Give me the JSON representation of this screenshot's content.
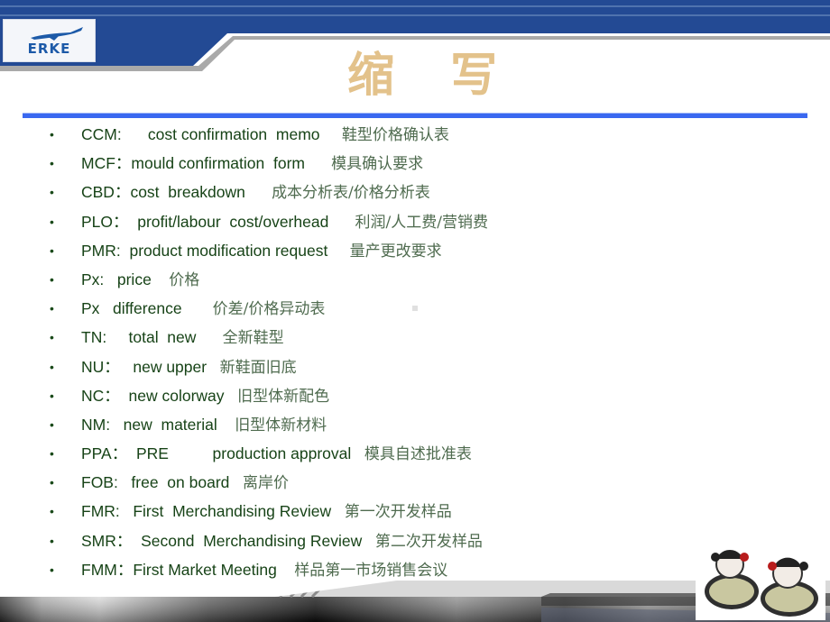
{
  "header": {
    "brand_logo_text": "ERKE",
    "colors": {
      "band": "#234a94",
      "band_shadow": "#a9a9a9",
      "title": "#e3c28b",
      "rule": "#3a68f0",
      "text": "#174317"
    }
  },
  "title": "缩 写",
  "items": [
    {
      "bullet": "•",
      "en": "CCM:      cost confirmation  memo     ",
      "cn": "鞋型价格确认表"
    },
    {
      "bullet": "•",
      "en": "MCF：mould confirmation  form      ",
      "cn": "模具确认要求"
    },
    {
      "bullet": "•",
      "en": "CBD：cost  breakdown      ",
      "cn": "成本分析表/价格分析表"
    },
    {
      "bullet": "•",
      "en": "PLO：  profit/labour  cost/overhead      ",
      "cn": "利润/人工费/营销费"
    },
    {
      "bullet": "•",
      "en": "PMR:  product modification request     ",
      "cn": "量产更改要求"
    },
    {
      "bullet": "•",
      "en": "Px:   price    ",
      "cn": "价格"
    },
    {
      "bullet": "•",
      "en": "Px   difference       ",
      "cn": "价差/价格异动表"
    },
    {
      "bullet": "•",
      "en": "TN:     total  new      ",
      "cn": "全新鞋型"
    },
    {
      "bullet": "•",
      "en": "NU：   new upper   ",
      "cn": "新鞋面旧底"
    },
    {
      "bullet": "•",
      "en": "NC：  new colorway   ",
      "cn": "旧型体新配色"
    },
    {
      "bullet": "•",
      "en": "NM:   new  material    ",
      "cn": "旧型体新材料"
    },
    {
      "bullet": "•",
      "en": "PPA：  PRE          production approval   ",
      "cn": "模具自述批准表"
    },
    {
      "bullet": "•",
      "en": "FOB:   free  on board   ",
      "cn": "离岸价"
    },
    {
      "bullet": "•",
      "en": "FMR:   First  Merchandising Review   ",
      "cn": "第一次开发样品"
    },
    {
      "bullet": "•",
      "en": "SMR：  Second  Merchandising Review   ",
      "cn": "第二次开发样品"
    },
    {
      "bullet": "•",
      "en": "FMM：First Market Meeting    ",
      "cn": "样品第一市场销售会议"
    }
  ],
  "images": {
    "sandals": "sandals-photo"
  }
}
